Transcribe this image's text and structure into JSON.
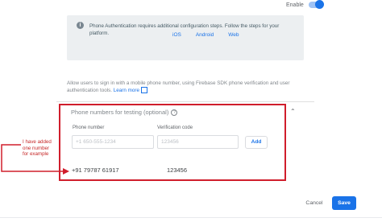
{
  "enable": {
    "label": "Enable",
    "on": true
  },
  "info": {
    "icon": "info-icon",
    "text": "Phone Authentication requires additional configuration steps. Follow the steps for your platform.",
    "platforms": [
      "iOS",
      "Android",
      "Web"
    ]
  },
  "allow": {
    "text": "Allow users to sign in with a mobile phone number, using Firebase SDK phone verification and user authentication tools.",
    "learn_more": "Learn more"
  },
  "testing": {
    "title": "Phone numbers for testing (optional)",
    "phone_label": "Phone number",
    "phone_placeholder": "+1 650-555-1234",
    "code_label": "Verification code",
    "code_placeholder": "123456",
    "add_label": "Add",
    "entry": {
      "phone": "+91 79787 61917",
      "code": "123456"
    }
  },
  "annotation": {
    "text": "I have added one number for example",
    "color": "#c62828"
  },
  "footer": {
    "cancel": "Cancel",
    "save": "Save"
  },
  "colors": {
    "accent": "#1a73e8",
    "highlight": "#d01e2c"
  }
}
